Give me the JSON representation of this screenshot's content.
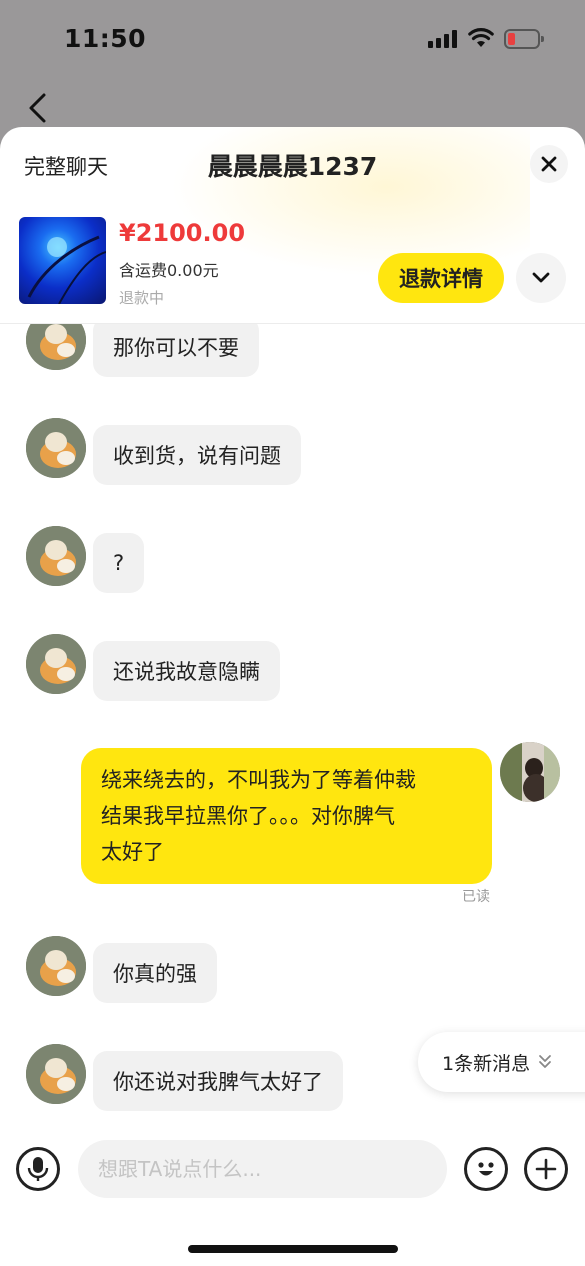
{
  "status_bar": {
    "time": "11:50"
  },
  "header": {
    "full_chat_label": "完整聊天",
    "title": "晨晨晨晨1237"
  },
  "product": {
    "price": "¥2100.00",
    "shipping": "含运费0.00元",
    "status": "退款中",
    "refund_button": "退款详情"
  },
  "messages": [
    {
      "side": "in",
      "text": "那你可以不要"
    },
    {
      "side": "in",
      "text": "收到货，说有问题"
    },
    {
      "side": "in",
      "text": "?"
    },
    {
      "side": "in",
      "text": "还说我故意隐瞒"
    },
    {
      "side": "out",
      "lines": [
        "绕来绕去的，不叫我为了等着仲裁",
        "结果我早拉黑你了。。。对你脾气",
        "太好了"
      ],
      "read_status": "已读"
    },
    {
      "side": "in",
      "text": "你真的强"
    },
    {
      "side": "in",
      "text": "你还说对我脾气太好了"
    }
  ],
  "new_message_pill": "1条新消息",
  "input": {
    "placeholder": "想跟TA说点什么..."
  },
  "colors": {
    "accent": "#ffe60f",
    "price": "#ee3a3a",
    "incoming_bubble": "#f1f1f1"
  },
  "icons": [
    "back-icon",
    "close-icon",
    "chevron-down-icon",
    "microphone-icon",
    "emoji-icon",
    "plus-icon",
    "double-chevron-down-icon"
  ]
}
